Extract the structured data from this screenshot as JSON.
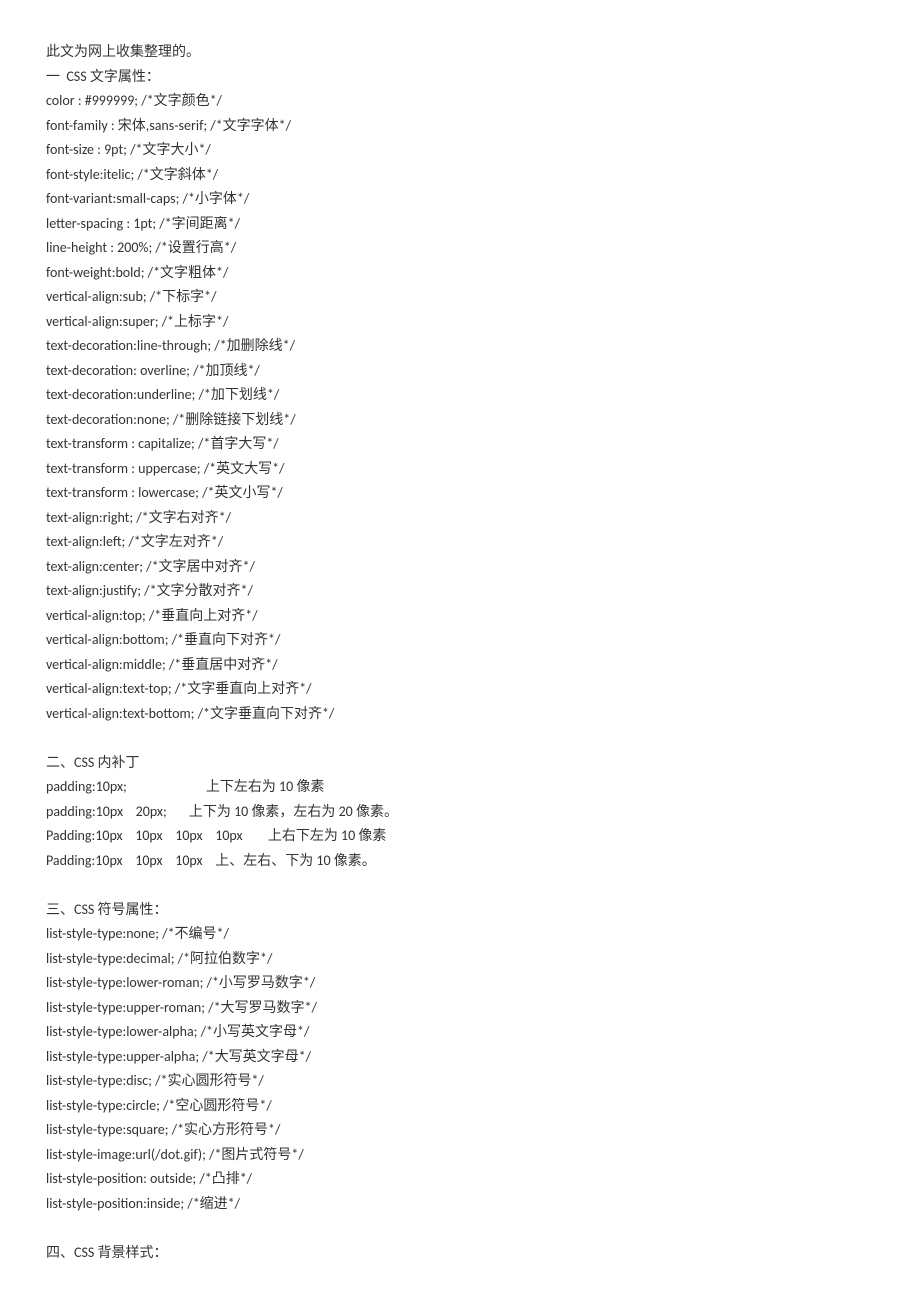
{
  "lines": [
    "此文为网上收集整理的。",
    "一  CSS 文字属性：",
    "color : #999999; /*文字颜色*/",
    "font-family : 宋体,sans-serif; /*文字字体*/",
    "font-size : 9pt; /*文字大小*/",
    "font-style:itelic; /*文字斜体*/",
    "font-variant:small-caps; /*小字体*/",
    "letter-spacing : 1pt; /*字间距离*/",
    "line-height : 200%; /*设置行高*/",
    "font-weight:bold; /*文字粗体*/",
    "vertical-align:sub; /*下标字*/",
    "vertical-align:super; /*上标字*/",
    "text-decoration:line-through; /*加删除线*/",
    "text-decoration: overline; /*加顶线*/",
    "text-decoration:underline; /*加下划线*/",
    "text-decoration:none; /*删除链接下划线*/",
    "text-transform : capitalize; /*首字大写*/",
    "text-transform : uppercase; /*英文大写*/",
    "text-transform : lowercase; /*英文小写*/",
    "text-align:right; /*文字右对齐*/",
    "text-align:left; /*文字左对齐*/",
    "text-align:center; /*文字居中对齐*/",
    "text-align:justify; /*文字分散对齐*/",
    "vertical-align:top; /*垂直向上对齐*/",
    "vertical-align:bottom; /*垂直向下对齐*/",
    "vertical-align:middle; /*垂直居中对齐*/",
    "vertical-align:text-top; /*文字垂直向上对齐*/",
    "vertical-align:text-bottom; /*文字垂直向下对齐*/",
    "",
    "二、CSS 内补丁",
    "padding:10px;                         上下左右为 10 像素",
    "padding:10px    20px;       上下为 10 像素，左右为 20 像素。",
    "Padding:10px    10px    10px    10px        上右下左为 10 像素",
    "Padding:10px    10px    10px    上、左右、下为 10 像素。",
    "",
    "三、CSS 符号属性：",
    "list-style-type:none; /*不编号*/",
    "list-style-type:decimal; /*阿拉伯数字*/",
    "list-style-type:lower-roman; /*小写罗马数字*/",
    "list-style-type:upper-roman; /*大写罗马数字*/",
    "list-style-type:lower-alpha; /*小写英文字母*/",
    "list-style-type:upper-alpha; /*大写英文字母*/",
    "list-style-type:disc; /*实心圆形符号*/",
    "list-style-type:circle; /*空心圆形符号*/",
    "list-style-type:square; /*实心方形符号*/",
    "list-style-image:url(/dot.gif); /*图片式符号*/",
    "list-style-position: outside; /*凸排*/",
    "list-style-position:inside; /*缩进*/",
    "",
    "四、CSS 背景样式："
  ]
}
